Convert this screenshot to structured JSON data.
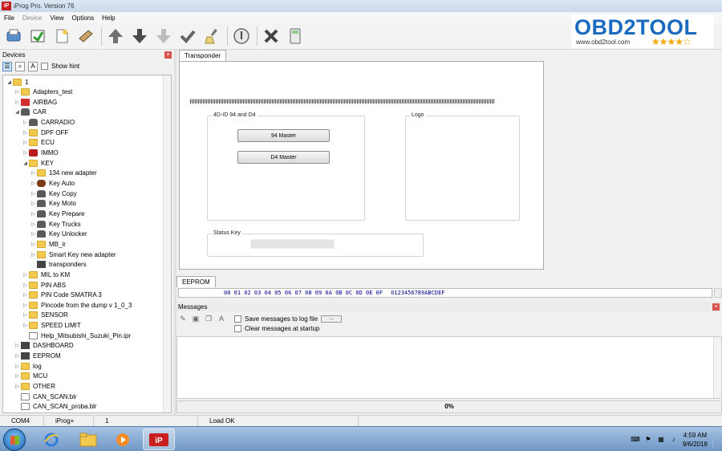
{
  "window": {
    "title": "iProg Pro. Version 76",
    "app_icon": "iP"
  },
  "menu": [
    {
      "label": "File",
      "disabled": false
    },
    {
      "label": "Device",
      "disabled": true
    },
    {
      "label": "View",
      "disabled": false
    },
    {
      "label": "Options",
      "disabled": false
    },
    {
      "label": "Help",
      "disabled": false
    }
  ],
  "toolbar": {
    "icons": [
      "open-device-icon",
      "save-device-icon",
      "new-file-icon",
      "edit-icon",
      "upload-arrow-icon",
      "download-arrow-icon",
      "download-disabled-icon",
      "check-icon",
      "erase-brush-icon",
      "info-icon",
      "cancel-x-icon",
      "calculator-icon"
    ]
  },
  "watermark": {
    "brand": "OBD2TOOL",
    "url": "www.obd2tool.com",
    "stars": "★★★★☆",
    "color": "#1a6bbf"
  },
  "devices": {
    "title": "Devices",
    "show_hint_label": "Show hint",
    "tree": [
      {
        "label": "1",
        "icon": "folder",
        "depth": 0,
        "exp": "◢"
      },
      {
        "label": "Adapters_test",
        "icon": "folder",
        "depth": 1,
        "exp": "▷"
      },
      {
        "label": "AIRBAG",
        "icon": "red",
        "depth": 1,
        "exp": "▷"
      },
      {
        "label": "CAR",
        "icon": "car",
        "depth": 1,
        "exp": "◢"
      },
      {
        "label": "CARRADIO",
        "icon": "car",
        "depth": 2,
        "exp": "▷"
      },
      {
        "label": "DPF OFF",
        "icon": "folder",
        "depth": 2,
        "exp": "▷"
      },
      {
        "label": "ECU",
        "icon": "folder",
        "depth": 2,
        "exp": "▷"
      },
      {
        "label": "IMMO",
        "icon": "lock",
        "depth": 2,
        "exp": "▷"
      },
      {
        "label": "KEY",
        "icon": "folder",
        "depth": 2,
        "exp": "◢"
      },
      {
        "label": "134 new adapter",
        "icon": "folder",
        "depth": 3,
        "exp": "▷"
      },
      {
        "label": "Key Auto",
        "icon": "bag",
        "depth": 3,
        "exp": "▷"
      },
      {
        "label": "Key Copy",
        "icon": "car",
        "depth": 3,
        "exp": "▷"
      },
      {
        "label": "Key Moto",
        "icon": "car",
        "depth": 3,
        "exp": "▷"
      },
      {
        "label": "Key Prepare",
        "icon": "car",
        "depth": 3,
        "exp": "▷"
      },
      {
        "label": "Key Trucks",
        "icon": "car",
        "depth": 3,
        "exp": "▷"
      },
      {
        "label": "Key Unlocker",
        "icon": "car",
        "depth": 3,
        "exp": "▷"
      },
      {
        "label": "MB_ir",
        "icon": "folder",
        "depth": 3,
        "exp": "▷"
      },
      {
        "label": "Smart Key new adapter",
        "icon": "folder",
        "depth": 3,
        "exp": "▷"
      },
      {
        "label": "transponders",
        "icon": "chip",
        "depth": 3,
        "exp": ""
      },
      {
        "label": "MIL to KM",
        "icon": "folder",
        "depth": 2,
        "exp": "▷"
      },
      {
        "label": "PIN ABS",
        "icon": "folder",
        "depth": 2,
        "exp": "▷"
      },
      {
        "label": "PIN Code SMATRA 3",
        "icon": "folder",
        "depth": 2,
        "exp": "▷"
      },
      {
        "label": "Pincode from the dump v 1_0_3",
        "icon": "folder",
        "depth": 2,
        "exp": "▷"
      },
      {
        "label": "SENSOR",
        "icon": "folder",
        "depth": 2,
        "exp": "▷"
      },
      {
        "label": "SPEED LIMIT",
        "icon": "folder",
        "depth": 2,
        "exp": "▷"
      },
      {
        "label": "Help_Mitsubishi_Suzuki_Pin.ipr",
        "icon": "file",
        "depth": 2,
        "exp": ""
      },
      {
        "label": "DASHBOARD",
        "icon": "chip",
        "depth": 1,
        "exp": "▷"
      },
      {
        "label": "EEPROM",
        "icon": "chip",
        "depth": 1,
        "exp": "▷"
      },
      {
        "label": "log",
        "icon": "folder",
        "depth": 1,
        "exp": "▷"
      },
      {
        "label": "MCU",
        "icon": "folder",
        "depth": 1,
        "exp": "▷"
      },
      {
        "label": "OTHER",
        "icon": "folder",
        "depth": 1,
        "exp": "▷"
      },
      {
        "label": "CAN_SCAN.blr",
        "icon": "file",
        "depth": 1,
        "exp": ""
      },
      {
        "label": "CAN_SCAN_proba.blr",
        "icon": "file",
        "depth": 1,
        "exp": ""
      }
    ]
  },
  "transponder": {
    "tab_label": "Transponder",
    "group_4d": {
      "title": "4D-ID 94 and D4",
      "btn_94": "94 Master",
      "btn_d4": "D4 Master"
    },
    "logo_group": {
      "title": "Logo"
    },
    "status_key": {
      "title": "Status Key"
    }
  },
  "eeprom": {
    "tab_label": "EEPROM",
    "hex_header": "00 01 02 03 04 05 06 07 08 09 0A 0B 0C 0D 0E 0F",
    "ascii_header": "0123456789ABCDEF"
  },
  "messages": {
    "title": "Messages",
    "save_log_label": "Save messages to log file",
    "save_log_btn": "...",
    "clear_startup_label": "Clear messages at startup",
    "progress_text": "0%",
    "progress_fraction": 0.0
  },
  "statusbar": {
    "port": "COM4",
    "device": "iProg+",
    "count": "1",
    "status": "Load OK"
  },
  "taskbar": {
    "time": "4:59 AM",
    "date": "9/6/2018"
  }
}
